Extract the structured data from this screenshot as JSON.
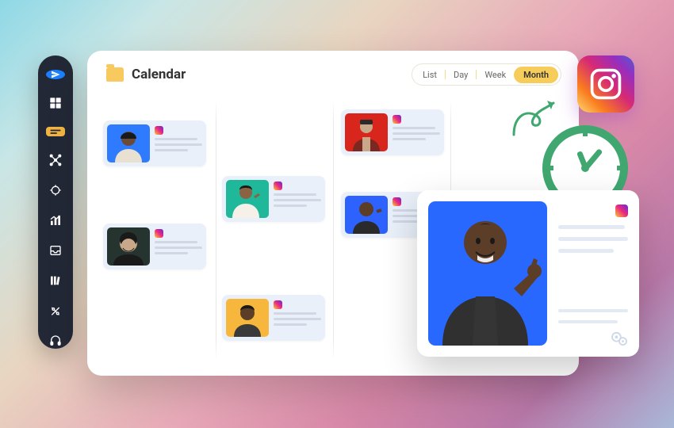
{
  "header": {
    "title": "Calendar"
  },
  "view_tabs": {
    "options": [
      "List",
      "Day",
      "Week",
      "Month"
    ],
    "selected": "Month"
  },
  "sidebar": {
    "items": [
      {
        "name": "send",
        "icon": "paper-plane",
        "active": "blue"
      },
      {
        "name": "dashboard",
        "icon": "grid"
      },
      {
        "name": "calendar",
        "icon": "card",
        "active": "yellow"
      },
      {
        "name": "network",
        "icon": "nodes"
      },
      {
        "name": "target",
        "icon": "crosshair"
      },
      {
        "name": "analytics",
        "icon": "bars"
      },
      {
        "name": "inbox",
        "icon": "tray"
      },
      {
        "name": "library",
        "icon": "books"
      },
      {
        "name": "settings",
        "icon": "tools"
      },
      {
        "name": "support",
        "icon": "headset"
      }
    ]
  },
  "columns": 4,
  "posts": [
    {
      "col": 0,
      "row": 0,
      "bg": "#2e7bff"
    },
    {
      "col": 0,
      "row": 1,
      "bg": "#2b3a38"
    },
    {
      "col": 1,
      "row": 0,
      "bg": "#1fb89a",
      "offset": 46
    },
    {
      "col": 1,
      "row": 1,
      "bg": "#f6b73c",
      "offset": 46
    },
    {
      "col": 2,
      "row": 0,
      "bg": "#d8261c",
      "offset": -12
    },
    {
      "col": 2,
      "row": 1,
      "bg": "#2e62ff",
      "offset": -12
    }
  ],
  "colors": {
    "accent": "#3fa76f",
    "yellow": "#f6cd5a"
  }
}
